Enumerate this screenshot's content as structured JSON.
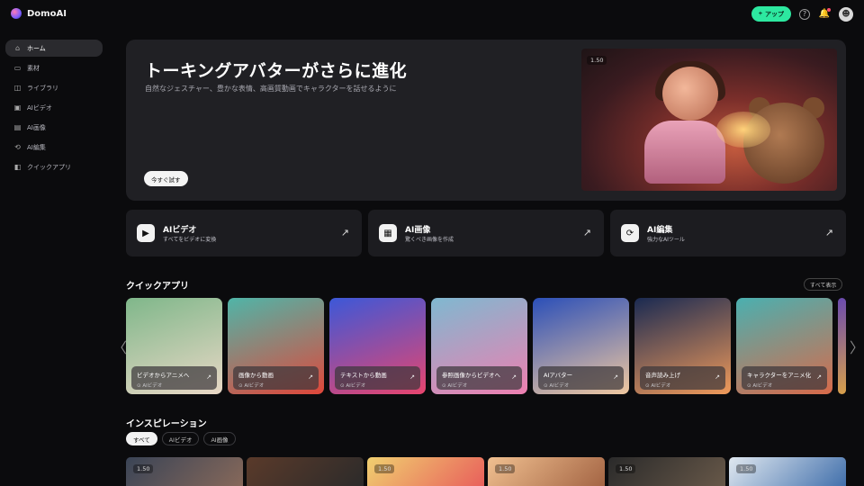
{
  "header": {
    "brand": "DomoAI",
    "upgrade_label": "アップ",
    "upgrade_icon": "+"
  },
  "sidebar": {
    "items": [
      {
        "label": "ホーム",
        "icon": "home-icon",
        "glyph": "⌂",
        "active": true
      },
      {
        "label": "素材",
        "icon": "assets-icon",
        "glyph": "▭",
        "active": false
      },
      {
        "label": "ライブラリ",
        "icon": "library-icon",
        "glyph": "◫",
        "active": false
      },
      {
        "label": "AIビデオ",
        "icon": "video-icon",
        "glyph": "▣",
        "active": false
      },
      {
        "label": "AI画像",
        "icon": "image-icon",
        "glyph": "▤",
        "active": false
      },
      {
        "label": "AI編集",
        "icon": "edit-icon",
        "glyph": "⟲",
        "active": false
      },
      {
        "label": "クイックアプリ",
        "icon": "quick-app-icon",
        "glyph": "◧",
        "active": false
      }
    ]
  },
  "hero": {
    "title": "トーキングアバターがさらに進化",
    "subtitle": "自然なジェスチャー、豊かな表情、高画質動画でキャラクターを話せるように",
    "cta": "今すぐ試す",
    "badge": "1.50"
  },
  "features": [
    {
      "title": "AIビデオ",
      "subtitle": "すべてをビデオに変換",
      "icon": "video-camera-icon",
      "glyph": "▶"
    },
    {
      "title": "AI画像",
      "subtitle": "驚くべき画像を作成",
      "icon": "picture-icon",
      "glyph": "▦"
    },
    {
      "title": "AI編集",
      "subtitle": "強力なAIツール",
      "icon": "magic-edit-icon",
      "glyph": "⟳"
    }
  ],
  "quick_apps": {
    "title": "クイックアプリ",
    "show_all": "すべて表示",
    "items": [
      {
        "name": "ビデオからアニメへ",
        "meta": "⊙ AIビデオ",
        "colors": [
          "#7fb78a",
          "#e9d8c6"
        ]
      },
      {
        "name": "画像から動画",
        "meta": "⊙ AIビデオ",
        "colors": [
          "#4fb5a8",
          "#e0473a"
        ]
      },
      {
        "name": "テキストから動画",
        "meta": "⊙ AIビデオ",
        "colors": [
          "#3c58d8",
          "#e8456e"
        ]
      },
      {
        "name": "参照画像からビデオへ",
        "meta": "⊙ AIビデオ",
        "colors": [
          "#7fb8d0",
          "#ee7fb0"
        ]
      },
      {
        "name": "AIアバター",
        "meta": "⊙ AIビデオ",
        "colors": [
          "#2b4fb8",
          "#f0c8a0"
        ]
      },
      {
        "name": "音声読み上げ",
        "meta": "⊙ AIビデオ",
        "colors": [
          "#1a2a52",
          "#f09a5a"
        ]
      },
      {
        "name": "キャラクターをアニメ化",
        "meta": "⊙ AIビデオ",
        "colors": [
          "#4ab0b0",
          "#d86a4a"
        ]
      }
    ]
  },
  "inspiration": {
    "title": "インスピレーション",
    "filters": [
      {
        "label": "すべて",
        "active": true
      },
      {
        "label": "AIビデオ",
        "active": false
      },
      {
        "label": "AI画像",
        "active": false
      }
    ],
    "items": [
      {
        "badge": "1.50",
        "colors": [
          "#3a4456",
          "#8a6a5a"
        ]
      },
      {
        "badge": "",
        "colors": [
          "#5a3a2a",
          "#2a2a2a"
        ]
      },
      {
        "badge": "1.50",
        "colors": [
          "#f0d070",
          "#e85a5a"
        ]
      },
      {
        "badge": "1.50",
        "colors": [
          "#f0c090",
          "#a06040"
        ]
      },
      {
        "badge": "1.50",
        "colors": [
          "#2a2a2a",
          "#6a5a4a"
        ]
      },
      {
        "badge": "1.50",
        "colors": [
          "#e0e8f0",
          "#3a6aa8"
        ]
      }
    ]
  }
}
